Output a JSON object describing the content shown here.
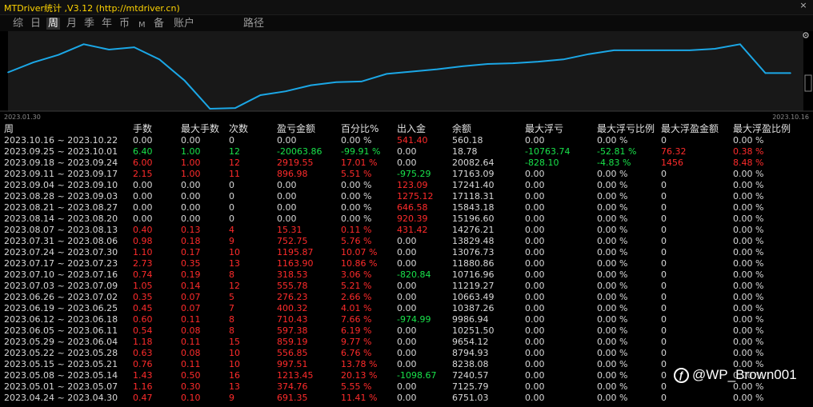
{
  "window": {
    "title": "MTDriver统计 ,V3.12 (http://mtdriver.cn)",
    "close_icon": "×"
  },
  "toolbar": {
    "tabs": [
      {
        "label": "综",
        "active": false,
        "small": false
      },
      {
        "label": "日",
        "active": false,
        "small": false
      },
      {
        "label": "周",
        "active": true,
        "small": false
      },
      {
        "label": "月",
        "active": false,
        "small": false
      },
      {
        "label": "季",
        "active": false,
        "small": false
      },
      {
        "label": "年",
        "active": false,
        "small": false
      },
      {
        "label": "币",
        "active": false,
        "small": false
      },
      {
        "label": "M",
        "active": false,
        "small": true
      },
      {
        "label": "备",
        "active": false,
        "small": false
      },
      {
        "label": "账户",
        "active": false,
        "small": false
      },
      {
        "label": "路径",
        "active": false,
        "small": false
      }
    ]
  },
  "chart_data": {
    "type": "line",
    "x_labels": [
      "2023.01.30",
      "2023.10.16"
    ],
    "values": [
      0.49,
      0.62,
      0.72,
      0.86,
      0.79,
      0.82,
      0.66,
      0.38,
      0.01,
      0.02,
      0.19,
      0.24,
      0.32,
      0.36,
      0.37,
      0.47,
      0.5,
      0.53,
      0.57,
      0.6,
      0.61,
      0.63,
      0.66,
      0.73,
      0.78,
      0.78,
      0.78,
      0.78,
      0.8,
      0.86,
      0.48,
      0.48
    ],
    "line_color": "#1ba7e6",
    "grid": false
  },
  "table": {
    "headers": [
      "周",
      "手数",
      "最大手数",
      "次数",
      "盈亏金额",
      "百分比%",
      "出入金",
      "余额",
      "最大浮亏",
      "最大浮亏比例",
      "最大浮盈金额",
      "最大浮盈比例"
    ],
    "rows": [
      {
        "week": "2023.10.16 ~ 2023.10.22",
        "lots": "0.00",
        "maxlots": "0.00",
        "count": "0",
        "pnl": "0.00",
        "pct": "0.00 %",
        "flow": "541.40",
        "bal": "560.18",
        "dd": "0.00",
        "ddpct": "0.00 %",
        "maxprofit": "0",
        "maxprofitpct": "0.00 %",
        "colors": {
          "lots": "white",
          "pnl": "white",
          "flow": "red",
          "dd": "white",
          "maxprofit": "white"
        }
      },
      {
        "week": "2023.09.25 ~ 2023.10.01",
        "lots": "6.40",
        "maxlots": "1.00",
        "count": "12",
        "pnl": "-20063.86",
        "pct": "-99.91 %",
        "flow": "0.00",
        "bal": "18.78",
        "dd": "-10763.74",
        "ddpct": "-52.81 %",
        "maxprofit": "76.32",
        "maxprofitpct": "0.38 %",
        "colors": {
          "lots": "green",
          "pnl": "green",
          "flow": "white",
          "dd": "green",
          "maxprofit": "red"
        }
      },
      {
        "week": "2023.09.18 ~ 2023.09.24",
        "lots": "6.00",
        "maxlots": "1.00",
        "count": "12",
        "pnl": "2919.55",
        "pct": "17.01 %",
        "flow": "0.00",
        "bal": "20082.64",
        "dd": "-828.10",
        "ddpct": "-4.83 %",
        "maxprofit": "1456",
        "maxprofitpct": "8.48 %",
        "colors": {
          "lots": "red",
          "pnl": "red",
          "flow": "white",
          "dd": "green",
          "maxprofit": "red"
        }
      },
      {
        "week": "2023.09.11 ~ 2023.09.17",
        "lots": "2.15",
        "maxlots": "1.00",
        "count": "11",
        "pnl": "896.98",
        "pct": "5.51 %",
        "flow": "-975.29",
        "bal": "17163.09",
        "dd": "0.00",
        "ddpct": "0.00 %",
        "maxprofit": "0",
        "maxprofitpct": "0.00 %",
        "colors": {
          "lots": "red",
          "pnl": "red",
          "flow": "green",
          "dd": "white",
          "maxprofit": "white"
        }
      },
      {
        "week": "2023.09.04 ~ 2023.09.10",
        "lots": "0.00",
        "maxlots": "0.00",
        "count": "0",
        "pnl": "0.00",
        "pct": "0.00 %",
        "flow": "123.09",
        "bal": "17241.40",
        "dd": "0.00",
        "ddpct": "0.00 %",
        "maxprofit": "0",
        "maxprofitpct": "0.00 %",
        "colors": {
          "lots": "white",
          "pnl": "white",
          "flow": "red",
          "dd": "white",
          "maxprofit": "white"
        }
      },
      {
        "week": "2023.08.28 ~ 2023.09.03",
        "lots": "0.00",
        "maxlots": "0.00",
        "count": "0",
        "pnl": "0.00",
        "pct": "0.00 %",
        "flow": "1275.12",
        "bal": "17118.31",
        "dd": "0.00",
        "ddpct": "0.00 %",
        "maxprofit": "0",
        "maxprofitpct": "0.00 %",
        "colors": {
          "lots": "white",
          "pnl": "white",
          "flow": "red",
          "dd": "white",
          "maxprofit": "white"
        }
      },
      {
        "week": "2023.08.21 ~ 2023.08.27",
        "lots": "0.00",
        "maxlots": "0.00",
        "count": "0",
        "pnl": "0.00",
        "pct": "0.00 %",
        "flow": "646.58",
        "bal": "15843.18",
        "dd": "0.00",
        "ddpct": "0.00 %",
        "maxprofit": "0",
        "maxprofitpct": "0.00 %",
        "colors": {
          "lots": "white",
          "pnl": "white",
          "flow": "red",
          "dd": "white",
          "maxprofit": "white"
        }
      },
      {
        "week": "2023.08.14 ~ 2023.08.20",
        "lots": "0.00",
        "maxlots": "0.00",
        "count": "0",
        "pnl": "0.00",
        "pct": "0.00 %",
        "flow": "920.39",
        "bal": "15196.60",
        "dd": "0.00",
        "ddpct": "0.00 %",
        "maxprofit": "0",
        "maxprofitpct": "0.00 %",
        "colors": {
          "lots": "white",
          "pnl": "white",
          "flow": "red",
          "dd": "white",
          "maxprofit": "white"
        }
      },
      {
        "week": "2023.08.07 ~ 2023.08.13",
        "lots": "0.40",
        "maxlots": "0.13",
        "count": "4",
        "pnl": "15.31",
        "pct": "0.11 %",
        "flow": "431.42",
        "bal": "14276.21",
        "dd": "0.00",
        "ddpct": "0.00 %",
        "maxprofit": "0",
        "maxprofitpct": "0.00 %",
        "colors": {
          "lots": "red",
          "pnl": "red",
          "flow": "red",
          "dd": "white",
          "maxprofit": "white"
        }
      },
      {
        "week": "2023.07.31 ~ 2023.08.06",
        "lots": "0.98",
        "maxlots": "0.18",
        "count": "9",
        "pnl": "752.75",
        "pct": "5.76 %",
        "flow": "0.00",
        "bal": "13829.48",
        "dd": "0.00",
        "ddpct": "0.00 %",
        "maxprofit": "0",
        "maxprofitpct": "0.00 %",
        "colors": {
          "lots": "red",
          "pnl": "red",
          "flow": "white",
          "dd": "white",
          "maxprofit": "white"
        }
      },
      {
        "week": "2023.07.24 ~ 2023.07.30",
        "lots": "1.10",
        "maxlots": "0.17",
        "count": "10",
        "pnl": "1195.87",
        "pct": "10.07 %",
        "flow": "0.00",
        "bal": "13076.73",
        "dd": "0.00",
        "ddpct": "0.00 %",
        "maxprofit": "0",
        "maxprofitpct": "0.00 %",
        "colors": {
          "lots": "red",
          "pnl": "red",
          "flow": "white",
          "dd": "white",
          "maxprofit": "white"
        }
      },
      {
        "week": "2023.07.17 ~ 2023.07.23",
        "lots": "2.73",
        "maxlots": "0.35",
        "count": "13",
        "pnl": "1163.90",
        "pct": "10.86 %",
        "flow": "0.00",
        "bal": "11880.86",
        "dd": "0.00",
        "ddpct": "0.00 %",
        "maxprofit": "0",
        "maxprofitpct": "0.00 %",
        "colors": {
          "lots": "red",
          "pnl": "red",
          "flow": "white",
          "dd": "white",
          "maxprofit": "white"
        }
      },
      {
        "week": "2023.07.10 ~ 2023.07.16",
        "lots": "0.74",
        "maxlots": "0.19",
        "count": "8",
        "pnl": "318.53",
        "pct": "3.06 %",
        "flow": "-820.84",
        "bal": "10716.96",
        "dd": "0.00",
        "ddpct": "0.00 %",
        "maxprofit": "0",
        "maxprofitpct": "0.00 %",
        "colors": {
          "lots": "red",
          "pnl": "red",
          "flow": "green",
          "dd": "white",
          "maxprofit": "white"
        }
      },
      {
        "week": "2023.07.03 ~ 2023.07.09",
        "lots": "1.05",
        "maxlots": "0.14",
        "count": "12",
        "pnl": "555.78",
        "pct": "5.21 %",
        "flow": "0.00",
        "bal": "11219.27",
        "dd": "0.00",
        "ddpct": "0.00 %",
        "maxprofit": "0",
        "maxprofitpct": "0.00 %",
        "colors": {
          "lots": "red",
          "pnl": "red",
          "flow": "white",
          "dd": "white",
          "maxprofit": "white"
        }
      },
      {
        "week": "2023.06.26 ~ 2023.07.02",
        "lots": "0.35",
        "maxlots": "0.07",
        "count": "5",
        "pnl": "276.23",
        "pct": "2.66 %",
        "flow": "0.00",
        "bal": "10663.49",
        "dd": "0.00",
        "ddpct": "0.00 %",
        "maxprofit": "0",
        "maxprofitpct": "0.00 %",
        "colors": {
          "lots": "red",
          "pnl": "red",
          "flow": "white",
          "dd": "white",
          "maxprofit": "white"
        }
      },
      {
        "week": "2023.06.19 ~ 2023.06.25",
        "lots": "0.45",
        "maxlots": "0.07",
        "count": "7",
        "pnl": "400.32",
        "pct": "4.01 %",
        "flow": "0.00",
        "bal": "10387.26",
        "dd": "0.00",
        "ddpct": "0.00 %",
        "maxprofit": "0",
        "maxprofitpct": "0.00 %",
        "colors": {
          "lots": "red",
          "pnl": "red",
          "flow": "white",
          "dd": "white",
          "maxprofit": "white"
        }
      },
      {
        "week": "2023.06.12 ~ 2023.06.18",
        "lots": "0.60",
        "maxlots": "0.11",
        "count": "8",
        "pnl": "710.43",
        "pct": "7.66 %",
        "flow": "-974.99",
        "bal": "9986.94",
        "dd": "0.00",
        "ddpct": "0.00 %",
        "maxprofit": "0",
        "maxprofitpct": "0.00 %",
        "colors": {
          "lots": "red",
          "pnl": "red",
          "flow": "green",
          "dd": "white",
          "maxprofit": "white"
        }
      },
      {
        "week": "2023.06.05 ~ 2023.06.11",
        "lots": "0.54",
        "maxlots": "0.08",
        "count": "8",
        "pnl": "597.38",
        "pct": "6.19 %",
        "flow": "0.00",
        "bal": "10251.50",
        "dd": "0.00",
        "ddpct": "0.00 %",
        "maxprofit": "0",
        "maxprofitpct": "0.00 %",
        "colors": {
          "lots": "red",
          "pnl": "red",
          "flow": "white",
          "dd": "white",
          "maxprofit": "white"
        }
      },
      {
        "week": "2023.05.29 ~ 2023.06.04",
        "lots": "1.18",
        "maxlots": "0.11",
        "count": "15",
        "pnl": "859.19",
        "pct": "9.77 %",
        "flow": "0.00",
        "bal": "9654.12",
        "dd": "0.00",
        "ddpct": "0.00 %",
        "maxprofit": "0",
        "maxprofitpct": "0.00 %",
        "colors": {
          "lots": "red",
          "pnl": "red",
          "flow": "white",
          "dd": "white",
          "maxprofit": "white"
        }
      },
      {
        "week": "2023.05.22 ~ 2023.05.28",
        "lots": "0.63",
        "maxlots": "0.08",
        "count": "10",
        "pnl": "556.85",
        "pct": "6.76 %",
        "flow": "0.00",
        "bal": "8794.93",
        "dd": "0.00",
        "ddpct": "0.00 %",
        "maxprofit": "0",
        "maxprofitpct": "0.00 %",
        "colors": {
          "lots": "red",
          "pnl": "red",
          "flow": "white",
          "dd": "white",
          "maxprofit": "white"
        }
      },
      {
        "week": "2023.05.15 ~ 2023.05.21",
        "lots": "0.76",
        "maxlots": "0.11",
        "count": "10",
        "pnl": "997.51",
        "pct": "13.78 %",
        "flow": "0.00",
        "bal": "8238.08",
        "dd": "0.00",
        "ddpct": "0.00 %",
        "maxprofit": "0",
        "maxprofitpct": "0.00 %",
        "colors": {
          "lots": "red",
          "pnl": "red",
          "flow": "white",
          "dd": "white",
          "maxprofit": "white"
        }
      },
      {
        "week": "2023.05.08 ~ 2023.05.14",
        "lots": "1.43",
        "maxlots": "0.50",
        "count": "16",
        "pnl": "1213.45",
        "pct": "20.13 %",
        "flow": "-1098.67",
        "bal": "7240.57",
        "dd": "0.00",
        "ddpct": "0.00 %",
        "maxprofit": "0",
        "maxprofitpct": "0.00 %",
        "colors": {
          "lots": "red",
          "pnl": "red",
          "flow": "green",
          "dd": "white",
          "maxprofit": "white"
        }
      },
      {
        "week": "2023.05.01 ~ 2023.05.07",
        "lots": "1.16",
        "maxlots": "0.30",
        "count": "13",
        "pnl": "374.76",
        "pct": "5.55 %",
        "flow": "0.00",
        "bal": "7125.79",
        "dd": "0.00",
        "ddpct": "0.00 %",
        "maxprofit": "0",
        "maxprofitpct": "0.00 %",
        "colors": {
          "lots": "red",
          "pnl": "red",
          "flow": "white",
          "dd": "white",
          "maxprofit": "white"
        }
      },
      {
        "week": "2023.04.24 ~ 2023.04.30",
        "lots": "0.47",
        "maxlots": "0.10",
        "count": "9",
        "pnl": "691.35",
        "pct": "11.41 %",
        "flow": "0.00",
        "bal": "6751.03",
        "dd": "0.00",
        "ddpct": "0.00 %",
        "maxprofit": "0",
        "maxprofitpct": "0.00 %",
        "colors": {
          "lots": "red",
          "pnl": "red",
          "flow": "white",
          "dd": "white",
          "maxprofit": "white"
        }
      }
    ]
  },
  "watermark": {
    "icon": "weibo-icon",
    "text": "@WP_Brown001"
  }
}
